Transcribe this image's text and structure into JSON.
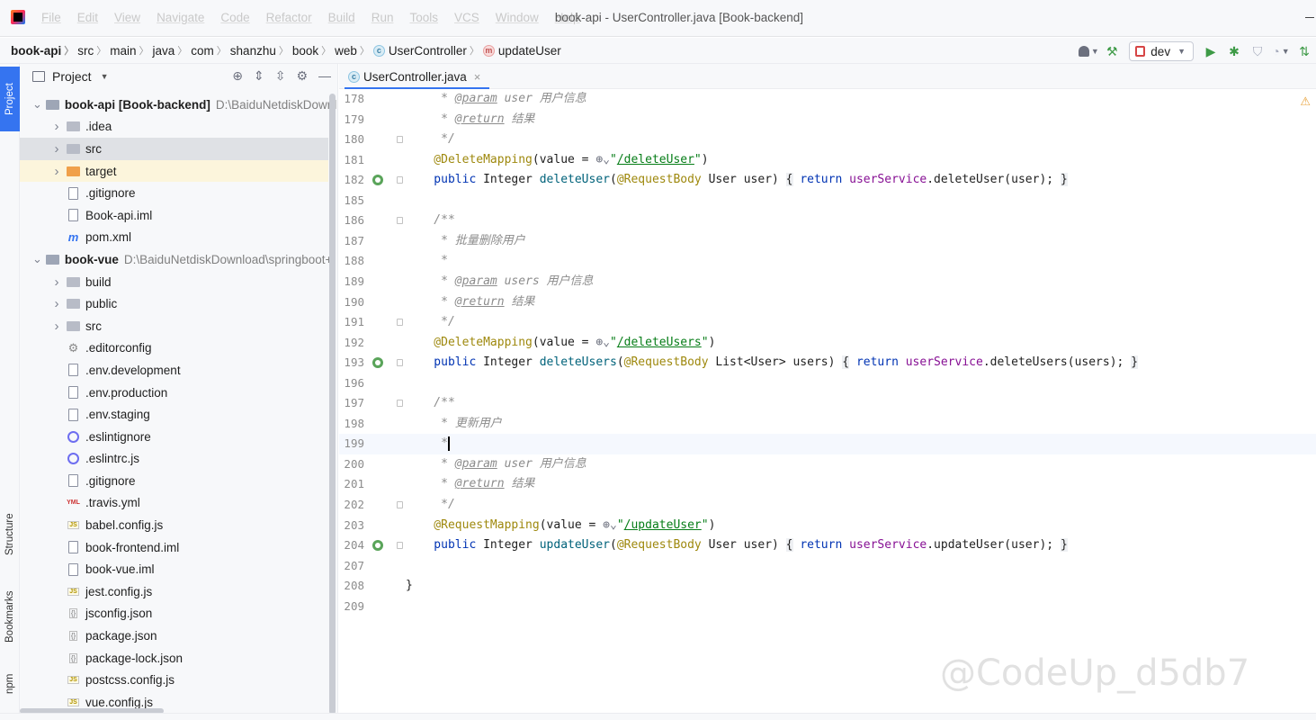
{
  "app": {
    "menu": [
      "File",
      "Edit",
      "View",
      "Navigate",
      "Code",
      "Refactor",
      "Build",
      "Run",
      "Tools",
      "VCS",
      "Window",
      "Help"
    ],
    "window_title": "book-api - UserController.java [Book-backend]"
  },
  "breadcrumb": [
    {
      "label": "book-api",
      "bold": true
    },
    {
      "label": "src"
    },
    {
      "label": "main"
    },
    {
      "label": "java"
    },
    {
      "label": "com"
    },
    {
      "label": "shanzhu"
    },
    {
      "label": "book"
    },
    {
      "label": "web"
    },
    {
      "label": "UserController",
      "badge": "C"
    },
    {
      "label": "updateUser",
      "badge": "m"
    }
  ],
  "run_config": "dev",
  "left_strip": {
    "project": "Project",
    "structure": "Structure",
    "bookmarks": "Bookmarks",
    "npm": "npm"
  },
  "project_panel": {
    "title": "Project",
    "tree": [
      {
        "depth": 0,
        "arrow": "open",
        "icon": "module-folder",
        "name": "book-api [Book-backend]",
        "bold": true,
        "path": "D:\\BaiduNetdiskDownl"
      },
      {
        "depth": 1,
        "arrow": "closed",
        "icon": "folder",
        "name": ".idea"
      },
      {
        "depth": 1,
        "arrow": "closed",
        "icon": "folder",
        "name": "src",
        "selected": true
      },
      {
        "depth": 1,
        "arrow": "closed",
        "icon": "folder-orange",
        "name": "target",
        "excluded": true
      },
      {
        "depth": 1,
        "arrow": "",
        "icon": "file",
        "name": ".gitignore"
      },
      {
        "depth": 1,
        "arrow": "",
        "icon": "file",
        "name": "Book-api.iml"
      },
      {
        "depth": 1,
        "arrow": "",
        "icon": "maven",
        "name": "pom.xml"
      },
      {
        "depth": 0,
        "arrow": "open",
        "icon": "module-folder",
        "name": "book-vue",
        "bold": true,
        "path": "D:\\BaiduNetdiskDownload\\springboot+"
      },
      {
        "depth": 1,
        "arrow": "closed",
        "icon": "folder",
        "name": "build"
      },
      {
        "depth": 1,
        "arrow": "closed",
        "icon": "folder",
        "name": "public"
      },
      {
        "depth": 1,
        "arrow": "closed",
        "icon": "folder",
        "name": "src"
      },
      {
        "depth": 1,
        "arrow": "",
        "icon": "gear",
        "name": ".editorconfig"
      },
      {
        "depth": 1,
        "arrow": "",
        "icon": "file",
        "name": ".env.development"
      },
      {
        "depth": 1,
        "arrow": "",
        "icon": "file",
        "name": ".env.production"
      },
      {
        "depth": 1,
        "arrow": "",
        "icon": "file",
        "name": ".env.staging"
      },
      {
        "depth": 1,
        "arrow": "",
        "icon": "eslint",
        "name": ".eslintignore"
      },
      {
        "depth": 1,
        "arrow": "",
        "icon": "eslint",
        "name": ".eslintrc.js"
      },
      {
        "depth": 1,
        "arrow": "",
        "icon": "file",
        "name": ".gitignore"
      },
      {
        "depth": 1,
        "arrow": "",
        "icon": "yml",
        "name": ".travis.yml"
      },
      {
        "depth": 1,
        "arrow": "",
        "icon": "js",
        "name": "babel.config.js"
      },
      {
        "depth": 1,
        "arrow": "",
        "icon": "file",
        "name": "book-frontend.iml"
      },
      {
        "depth": 1,
        "arrow": "",
        "icon": "file",
        "name": "book-vue.iml"
      },
      {
        "depth": 1,
        "arrow": "",
        "icon": "js",
        "name": "jest.config.js"
      },
      {
        "depth": 1,
        "arrow": "",
        "icon": "json",
        "name": "jsconfig.json"
      },
      {
        "depth": 1,
        "arrow": "",
        "icon": "json",
        "name": "package.json"
      },
      {
        "depth": 1,
        "arrow": "",
        "icon": "json",
        "name": "package-lock.json"
      },
      {
        "depth": 1,
        "arrow": "",
        "icon": "js",
        "name": "postcss.config.js"
      },
      {
        "depth": 1,
        "arrow": "",
        "icon": "js",
        "name": "vue.config.js"
      }
    ]
  },
  "editor": {
    "tab_label": "UserController.java",
    "lines": [
      {
        "n": "178",
        "tokens": [
          [
            "cm",
            "     * "
          ],
          [
            "tg",
            "@param"
          ],
          [
            "cm",
            " "
          ],
          [
            "cmi",
            "user"
          ],
          [
            "cm",
            " 用户信息"
          ]
        ]
      },
      {
        "n": "179",
        "tokens": [
          [
            "cm",
            "     * "
          ],
          [
            "tg",
            "@return"
          ],
          [
            "cm",
            " 结果"
          ]
        ]
      },
      {
        "n": "180",
        "fold": true,
        "tokens": [
          [
            "cm",
            "     */"
          ]
        ]
      },
      {
        "n": "181",
        "tokens": [
          [
            "ann",
            "    @DeleteMapping"
          ],
          [
            "p",
            "(value = "
          ],
          [
            "globe",
            "⊕⌄"
          ],
          [
            "str",
            "\""
          ],
          [
            "lnk",
            "/deleteUser"
          ],
          [
            "str",
            "\""
          ],
          [
            "p",
            ")"
          ]
        ]
      },
      {
        "n": "182",
        "gicon": true,
        "fold": true,
        "tokens": [
          [
            "kw",
            "    public "
          ],
          [
            "p",
            "Integer "
          ],
          [
            "fn",
            "deleteUser"
          ],
          [
            "p",
            "("
          ],
          [
            "ann",
            "@RequestBody"
          ],
          [
            "p",
            " User user) "
          ],
          [
            "brace",
            "{"
          ],
          [
            "p",
            " "
          ],
          [
            "kw",
            "return "
          ],
          [
            "fld",
            "userService"
          ],
          [
            "p",
            ".deleteUser(user); "
          ],
          [
            "brace",
            "}"
          ]
        ]
      },
      {
        "n": "185",
        "tokens": []
      },
      {
        "n": "186",
        "fold": true,
        "tokens": [
          [
            "cm",
            "    /**"
          ]
        ]
      },
      {
        "n": "187",
        "tokens": [
          [
            "cm",
            "     * 批量删除用户"
          ]
        ]
      },
      {
        "n": "188",
        "tokens": [
          [
            "cm",
            "     *"
          ]
        ]
      },
      {
        "n": "189",
        "tokens": [
          [
            "cm",
            "     * "
          ],
          [
            "tg",
            "@param"
          ],
          [
            "cm",
            " "
          ],
          [
            "cmi",
            "users"
          ],
          [
            "cm",
            " 用户信息"
          ]
        ]
      },
      {
        "n": "190",
        "tokens": [
          [
            "cm",
            "     * "
          ],
          [
            "tg",
            "@return"
          ],
          [
            "cm",
            " 结果"
          ]
        ]
      },
      {
        "n": "191",
        "fold": true,
        "tokens": [
          [
            "cm",
            "     */"
          ]
        ]
      },
      {
        "n": "192",
        "tokens": [
          [
            "ann",
            "    @DeleteMapping"
          ],
          [
            "p",
            "(value = "
          ],
          [
            "globe",
            "⊕⌄"
          ],
          [
            "str",
            "\""
          ],
          [
            "lnk",
            "/deleteUsers"
          ],
          [
            "str",
            "\""
          ],
          [
            "p",
            ")"
          ]
        ]
      },
      {
        "n": "193",
        "gicon": true,
        "fold": true,
        "tokens": [
          [
            "kw",
            "    public "
          ],
          [
            "p",
            "Integer "
          ],
          [
            "fn",
            "deleteUsers"
          ],
          [
            "p",
            "("
          ],
          [
            "ann",
            "@RequestBody"
          ],
          [
            "p",
            " List<User> users) "
          ],
          [
            "brace",
            "{"
          ],
          [
            "p",
            " "
          ],
          [
            "kw",
            "return "
          ],
          [
            "fld",
            "userService"
          ],
          [
            "p",
            ".deleteUsers(users); "
          ],
          [
            "brace",
            "}"
          ]
        ]
      },
      {
        "n": "196",
        "tokens": []
      },
      {
        "n": "197",
        "fold": true,
        "tokens": [
          [
            "cm",
            "    /**"
          ]
        ]
      },
      {
        "n": "198",
        "tokens": [
          [
            "cm",
            "     * 更新用户"
          ]
        ]
      },
      {
        "n": "199",
        "caret": true,
        "tokens": [
          [
            "cm",
            "     *"
          ],
          [
            "cursor",
            ""
          ]
        ]
      },
      {
        "n": "200",
        "tokens": [
          [
            "cm",
            "     * "
          ],
          [
            "tg",
            "@param"
          ],
          [
            "cm",
            " "
          ],
          [
            "cmi",
            "user"
          ],
          [
            "cm",
            " 用户信息"
          ]
        ]
      },
      {
        "n": "201",
        "tokens": [
          [
            "cm",
            "     * "
          ],
          [
            "tg",
            "@return"
          ],
          [
            "cm",
            " 结果"
          ]
        ]
      },
      {
        "n": "202",
        "fold": true,
        "tokens": [
          [
            "cm",
            "     */"
          ]
        ]
      },
      {
        "n": "203",
        "tokens": [
          [
            "ann",
            "    @RequestMapping"
          ],
          [
            "p",
            "(value = "
          ],
          [
            "globe",
            "⊕⌄"
          ],
          [
            "str",
            "\""
          ],
          [
            "lnk",
            "/updateUser"
          ],
          [
            "str",
            "\""
          ],
          [
            "p",
            ")"
          ]
        ]
      },
      {
        "n": "204",
        "gicon": true,
        "fold": true,
        "tokens": [
          [
            "kw",
            "    public "
          ],
          [
            "p",
            "Integer "
          ],
          [
            "fn",
            "updateUser"
          ],
          [
            "p",
            "("
          ],
          [
            "ann",
            "@RequestBody"
          ],
          [
            "p",
            " User user) "
          ],
          [
            "brace",
            "{"
          ],
          [
            "p",
            " "
          ],
          [
            "kw",
            "return "
          ],
          [
            "fld",
            "userService"
          ],
          [
            "p",
            ".updateUser(user); "
          ],
          [
            "brace",
            "}"
          ]
        ]
      },
      {
        "n": "207",
        "tokens": []
      },
      {
        "n": "208",
        "tokens": [
          [
            "p",
            "}"
          ]
        ]
      },
      {
        "n": "209",
        "tokens": []
      }
    ]
  },
  "watermark": "@CodeUp_d5db7",
  "colors": {
    "accent": "#3574f0",
    "keyword": "#0033b3",
    "annotation": "#9e880d",
    "string": "#067d17",
    "comment": "#8c8c8c",
    "function": "#00627a",
    "field": "#871094"
  }
}
